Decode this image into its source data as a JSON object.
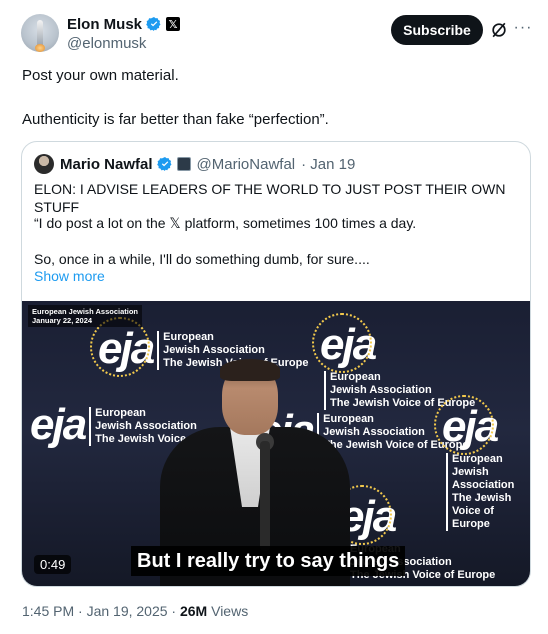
{
  "author": {
    "name": "Elon Musk",
    "handle": "@elonmusk",
    "org_badge": "𝕏"
  },
  "actions": {
    "subscribe_label": "Subscribe",
    "more_label": "···"
  },
  "post": {
    "line1": "Post your own material.",
    "line2": "Authenticity is far better than fake “perfection”."
  },
  "quote": {
    "name": "Mario Nawfal",
    "handle": "@MarioNawfal",
    "date": "· Jan 19",
    "text1": "ELON: I ADVISE LEADERS OF THE WORLD TO JUST POST THEIR OWN STUFF",
    "text2": "“I do post a lot on the 𝕏 platform, sometimes 100 times a day.",
    "text3": "So, once in a while, I'll do something dumb, for sure....",
    "show_more": "Show more",
    "video": {
      "watermark_line1": "European Jewish Association",
      "watermark_line2": "January 22, 2024",
      "caption": "But I really try to say things",
      "duration": "0:49",
      "logo_mark": "eja",
      "logo_line1": "European",
      "logo_line2": "Jewish Association",
      "logo_line3": "The Jewish Voice of Europe"
    }
  },
  "meta": {
    "timestamp": "1:45 PM · Jan 19, 2025 · ",
    "views_count": "26M",
    "views_label": " Views"
  },
  "colors": {
    "verified_blue": "#1d9bf0",
    "link_blue": "#1d9bf0",
    "text_primary": "#0f1419",
    "text_secondary": "#536471"
  }
}
